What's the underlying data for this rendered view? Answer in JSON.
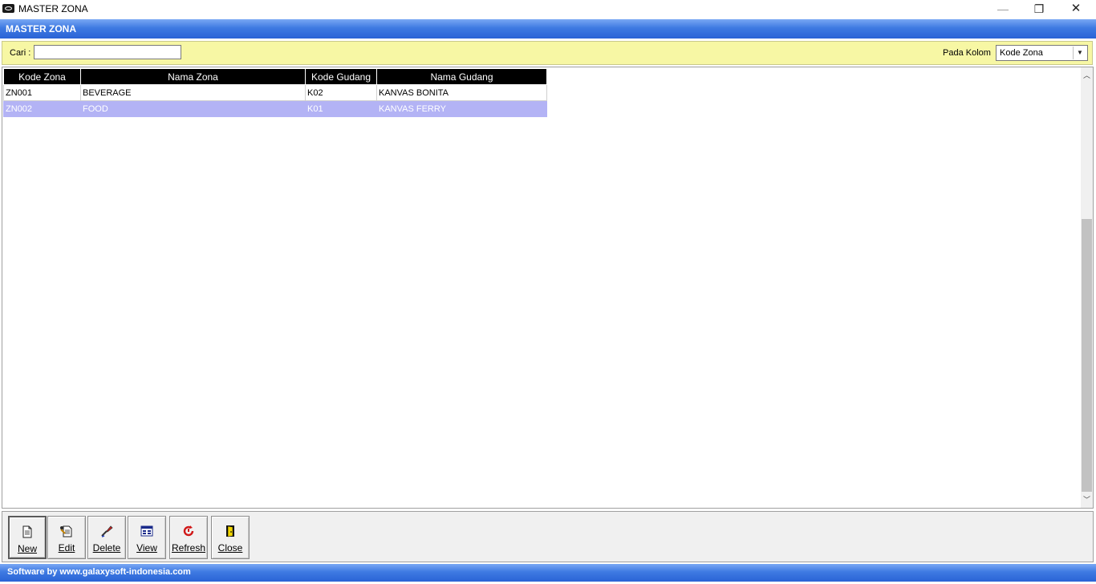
{
  "window": {
    "title": "MASTER ZONA",
    "minimize_glyph": "—",
    "maximize_glyph": "❐",
    "close_glyph": "✕"
  },
  "header": {
    "title": "MASTER ZONA"
  },
  "search": {
    "label": "Cari :",
    "value": "",
    "column_label": "Pada Kolom",
    "column_selected": "Kode Zona"
  },
  "grid": {
    "columns": [
      "Kode Zona",
      "Nama Zona",
      "Kode Gudang",
      "Nama Gudang"
    ],
    "rows": [
      [
        "ZN001",
        "BEVERAGE",
        "K02",
        "KANVAS BONITA"
      ],
      [
        "ZN002",
        "FOOD",
        "K01",
        "KANVAS FERRY"
      ]
    ],
    "selected_row": 2
  },
  "toolbar": {
    "buttons": [
      {
        "label": "New",
        "icon": "new-document-icon"
      },
      {
        "label": "Edit",
        "icon": "edit-document-icon"
      },
      {
        "label": "Delete",
        "icon": "eraser-icon"
      },
      {
        "label": "View",
        "icon": "view-window-icon"
      },
      {
        "label": "Refresh",
        "icon": "refresh-icon"
      },
      {
        "label": "Close",
        "icon": "exit-door-icon"
      }
    ]
  },
  "footer": {
    "text": "Software by www.galaxysoft-indonesia.com"
  },
  "colors": {
    "header_blue": "#3e7ae2",
    "search_bar_yellow": "#f7f7a4",
    "grid_header_bg": "#000000",
    "selected_row_bg": "#b3b3f5"
  }
}
